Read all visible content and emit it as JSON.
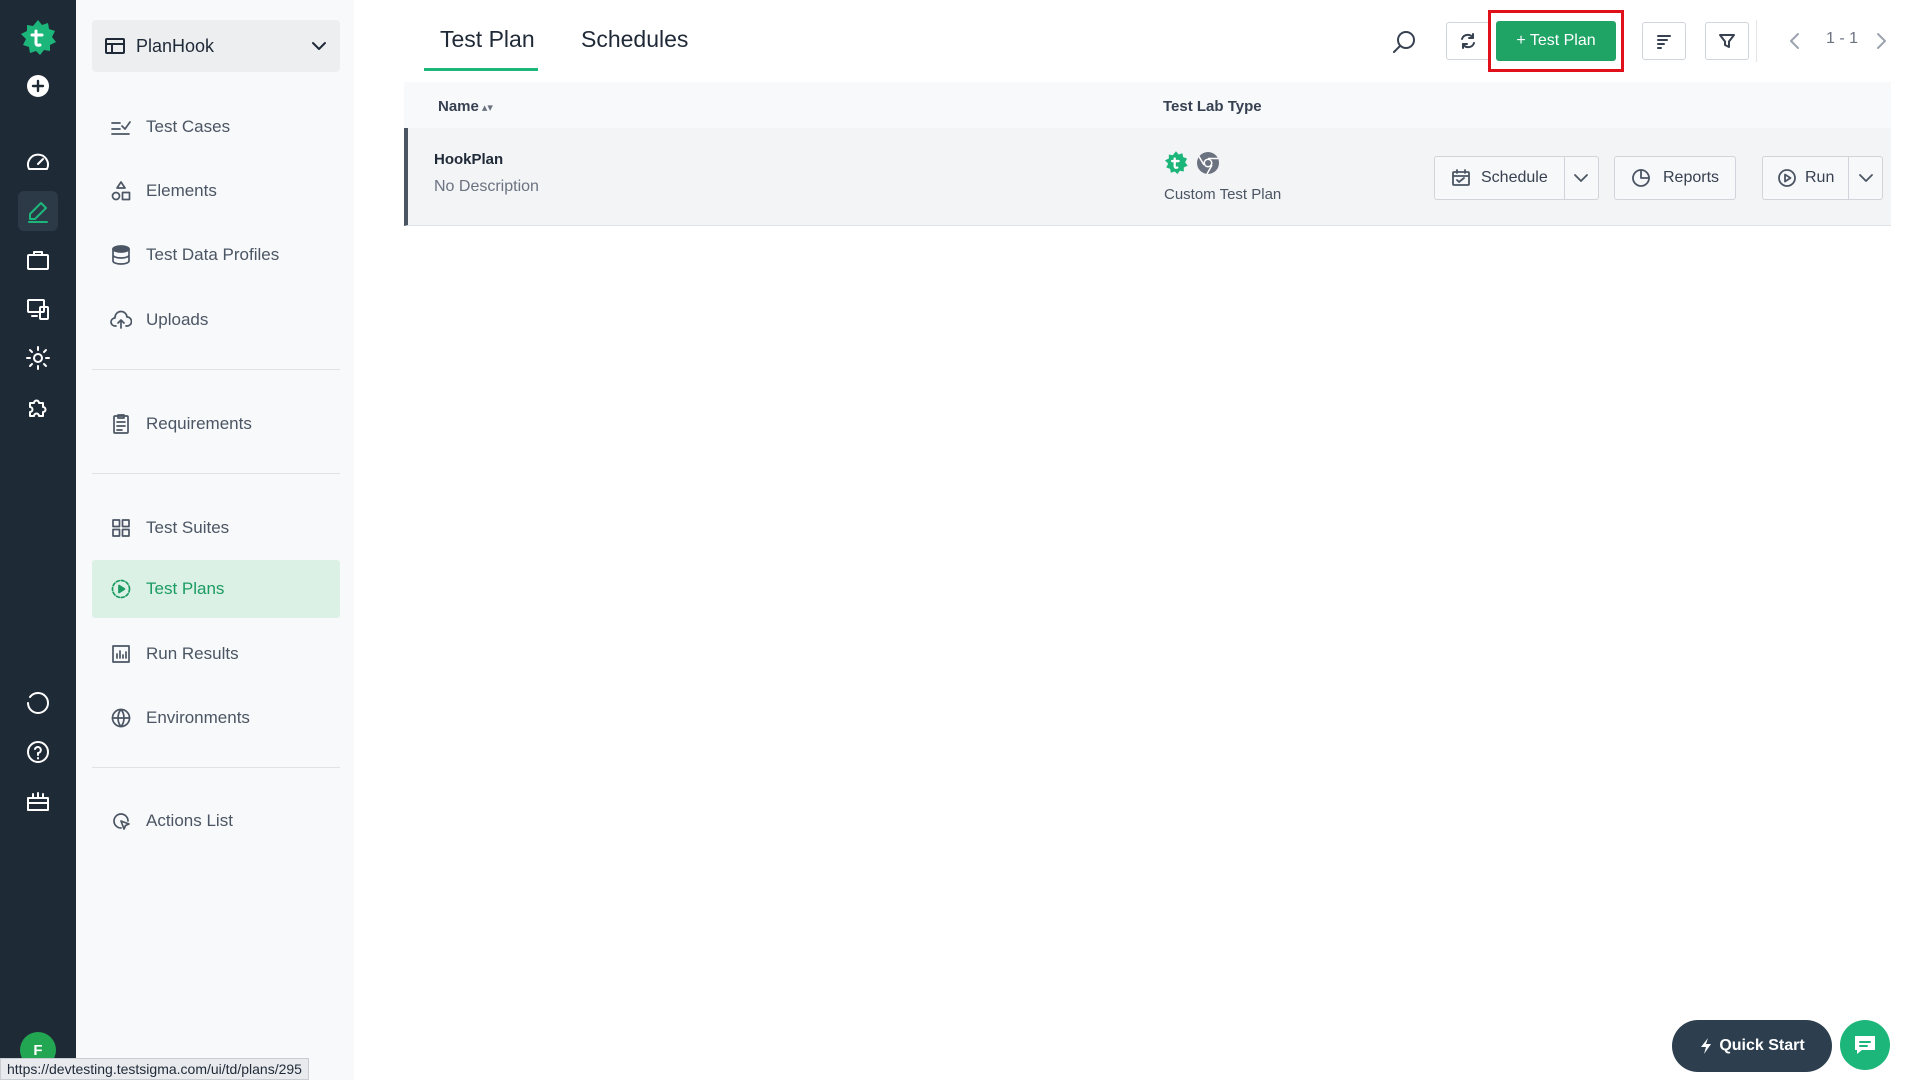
{
  "project": {
    "name": "PlanHook"
  },
  "sidebar": {
    "items": [
      {
        "label": "Test Cases"
      },
      {
        "label": "Elements"
      },
      {
        "label": "Test Data Profiles"
      },
      {
        "label": "Uploads"
      },
      {
        "label": "Requirements"
      },
      {
        "label": "Test Suites"
      },
      {
        "label": "Test Plans"
      },
      {
        "label": "Run Results"
      },
      {
        "label": "Environments"
      },
      {
        "label": "Actions List"
      }
    ]
  },
  "tabs": [
    {
      "label": "Test Plan"
    },
    {
      "label": "Schedules"
    }
  ],
  "toolbar": {
    "add_label": "+ Test Plan",
    "pager": "1 - 1"
  },
  "table": {
    "headers": {
      "name": "Name",
      "lab": "Test Lab Type"
    },
    "rows": [
      {
        "name": "HookPlan",
        "description": "No Description",
        "lab_type": "Custom Test Plan"
      }
    ],
    "actions": {
      "schedule": "Schedule",
      "reports": "Reports",
      "run": "Run"
    }
  },
  "footer": {
    "quick_start": "Quick Start",
    "status_url": "https://devtesting.testsigma.com/ui/td/plans/295"
  },
  "user": {
    "initial": "F"
  },
  "colors": {
    "accent": "#1db67a",
    "primary_button": "#20a466",
    "highlight": "#e0101b",
    "rail": "#1f2a37"
  },
  "icons": {
    "rail": [
      "testsigma-logo-icon",
      "add-circle-icon",
      "dashboard-icon",
      "edit-icon",
      "briefcase-icon",
      "devices-icon",
      "settings-icon",
      "addons-icon",
      "sync-icon",
      "help-icon",
      "gift-icon"
    ]
  }
}
